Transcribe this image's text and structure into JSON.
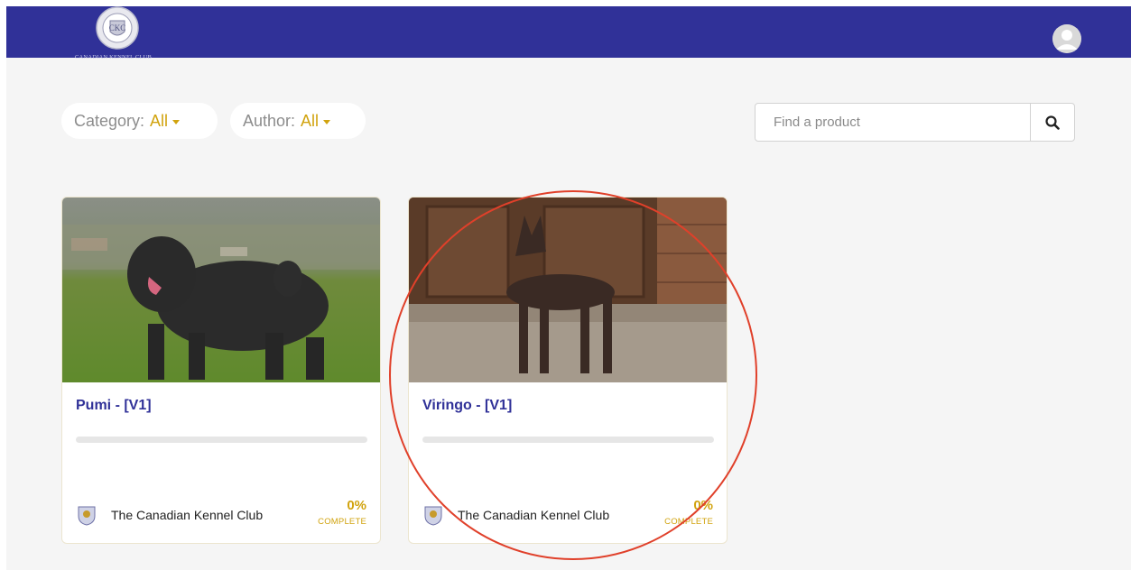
{
  "header": {
    "logo_text": "CANADIAN KENNEL CLUB",
    "logo_icon": "ckc-crest-icon",
    "user_icon": "user-avatar-icon"
  },
  "filters": {
    "category": {
      "label": "Category:",
      "value": "All"
    },
    "author": {
      "label": "Author:",
      "value": "All"
    }
  },
  "search": {
    "placeholder": "Find a product",
    "value": "",
    "icon": "search-icon"
  },
  "products": [
    {
      "title": "Pumi - [V1]",
      "author": "The Canadian Kennel Club",
      "progress_percent": 0,
      "percent_label": "0%",
      "complete_label": "COMPLETE",
      "image_icon": "black-curly-dog-photo"
    },
    {
      "title": "Viringo - [V1]",
      "author": "The Canadian Kennel Club",
      "progress_percent": 0,
      "percent_label": "0%",
      "complete_label": "COMPLETE",
      "image_icon": "hairless-dog-photo"
    }
  ],
  "colors": {
    "header_bg": "#303198",
    "accent_gold": "#d1a30e",
    "title_blue": "#303198",
    "annotation_red": "#e0402a"
  }
}
